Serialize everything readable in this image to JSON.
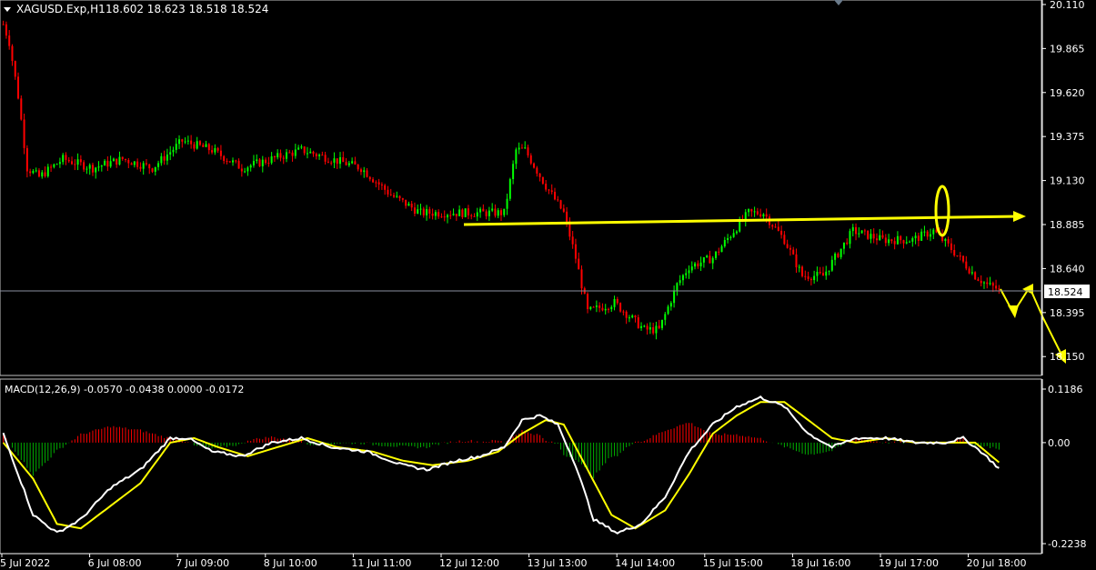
{
  "header": {
    "symbol_label": "XAGUSD.Exp,H1",
    "ohlc_label": "18.602 18.623 18.518 18.524"
  },
  "macd_header": {
    "label": "MACD(12,26,9) -0.0570 -0.0438 0.0000 -0.0172"
  },
  "price_marker": {
    "label": "18.524",
    "value": 18.524
  },
  "colors": {
    "background": "#000000",
    "bull_candle": "#00ff00",
    "bear_candle": "#ff0000",
    "axis": "#ffffff",
    "annotation": "#ffff00",
    "macd_line": "#ffffff",
    "signal_line": "#ffff00",
    "hist_positive": "#ff0000",
    "hist_negative": "#00b000"
  },
  "chart_data": [
    {
      "type": "candlestick",
      "symbol": "XAGUSD.Exp",
      "timeframe": "H1",
      "ylim": [
        18.05,
        20.13
      ],
      "y_ticks": [
        "20.110",
        "19.865",
        "19.620",
        "19.375",
        "19.130",
        "18.885",
        "18.640",
        "18.395",
        "18.150"
      ],
      "x_ticks": [
        "5 Jul 2022",
        "6 Jul 08:00",
        "7 Jul 09:00",
        "8 Jul 10:00",
        "11 Jul 11:00",
        "12 Jul 12:00",
        "13 Jul 13:00",
        "14 Jul 14:00",
        "15 Jul 15:00",
        "18 Jul 16:00",
        "19 Jul 17:00",
        "20 Jul 18:00"
      ],
      "grid": false,
      "current_price": 18.524,
      "path_keypoints": [
        [
          0,
          20.0
        ],
        [
          2,
          19.9
        ],
        [
          5,
          19.6
        ],
        [
          8,
          19.2
        ],
        [
          12,
          19.15
        ],
        [
          20,
          19.25
        ],
        [
          30,
          19.2
        ],
        [
          40,
          19.25
        ],
        [
          50,
          19.2
        ],
        [
          60,
          19.35
        ],
        [
          70,
          19.3
        ],
        [
          80,
          19.2
        ],
        [
          90,
          19.25
        ],
        [
          100,
          19.3
        ],
        [
          110,
          19.25
        ],
        [
          120,
          19.2
        ],
        [
          130,
          19.05
        ],
        [
          140,
          18.95
        ],
        [
          150,
          18.95
        ],
        [
          160,
          18.95
        ],
        [
          168,
          18.95
        ],
        [
          172,
          19.3
        ],
        [
          175,
          19.3
        ],
        [
          182,
          19.1
        ],
        [
          188,
          18.95
        ],
        [
          192,
          18.7
        ],
        [
          196,
          18.4
        ],
        [
          205,
          18.45
        ],
        [
          215,
          18.3
        ],
        [
          220,
          18.3
        ],
        [
          226,
          18.55
        ],
        [
          230,
          18.65
        ],
        [
          238,
          18.7
        ],
        [
          245,
          18.85
        ],
        [
          250,
          18.95
        ],
        [
          255,
          18.95
        ],
        [
          262,
          18.8
        ],
        [
          268,
          18.6
        ],
        [
          275,
          18.6
        ],
        [
          285,
          18.85
        ],
        [
          295,
          18.8
        ],
        [
          305,
          18.8
        ],
        [
          312,
          18.85
        ],
        [
          318,
          18.75
        ],
        [
          326,
          18.6
        ],
        [
          330,
          18.55
        ],
        [
          334,
          18.524
        ]
      ]
    },
    {
      "type": "macd",
      "params": "12,26,9",
      "values": {
        "macd": -0.057,
        "signal": -0.0438,
        "zero": 0.0,
        "histogram": -0.0172
      },
      "ylim": [
        -0.2238,
        0.1186
      ],
      "y_ticks": [
        "0.1186",
        "0.00",
        "-0.2238"
      ],
      "macd_keypoints": [
        [
          0,
          0.02
        ],
        [
          10,
          -0.16
        ],
        [
          18,
          -0.2
        ],
        [
          26,
          -0.17
        ],
        [
          36,
          -0.1
        ],
        [
          46,
          -0.06
        ],
        [
          56,
          0.01
        ],
        [
          62,
          0.01
        ],
        [
          70,
          -0.02
        ],
        [
          80,
          -0.03
        ],
        [
          90,
          0.0
        ],
        [
          100,
          0.01
        ],
        [
          110,
          -0.01
        ],
        [
          122,
          -0.02
        ],
        [
          134,
          -0.05
        ],
        [
          142,
          -0.06
        ],
        [
          152,
          -0.04
        ],
        [
          160,
          -0.03
        ],
        [
          168,
          -0.01
        ],
        [
          174,
          0.05
        ],
        [
          180,
          0.06
        ],
        [
          186,
          0.04
        ],
        [
          192,
          -0.05
        ],
        [
          198,
          -0.17
        ],
        [
          206,
          -0.2
        ],
        [
          214,
          -0.18
        ],
        [
          222,
          -0.12
        ],
        [
          230,
          -0.02
        ],
        [
          238,
          0.04
        ],
        [
          246,
          0.08
        ],
        [
          254,
          0.1
        ],
        [
          262,
          0.08
        ],
        [
          270,
          0.02
        ],
        [
          278,
          -0.01
        ],
        [
          286,
          0.01
        ],
        [
          296,
          0.01
        ],
        [
          306,
          0.0
        ],
        [
          316,
          0.0
        ],
        [
          322,
          0.01
        ],
        [
          328,
          -0.02
        ],
        [
          334,
          -0.057
        ]
      ],
      "signal_keypoints": [
        [
          0,
          0.0
        ],
        [
          10,
          -0.08
        ],
        [
          18,
          -0.18
        ],
        [
          26,
          -0.19
        ],
        [
          36,
          -0.14
        ],
        [
          46,
          -0.09
        ],
        [
          56,
          0.0
        ],
        [
          64,
          0.01
        ],
        [
          72,
          -0.01
        ],
        [
          82,
          -0.03
        ],
        [
          92,
          -0.01
        ],
        [
          102,
          0.01
        ],
        [
          112,
          -0.01
        ],
        [
          124,
          -0.02
        ],
        [
          134,
          -0.04
        ],
        [
          144,
          -0.05
        ],
        [
          156,
          -0.04
        ],
        [
          166,
          -0.02
        ],
        [
          174,
          0.02
        ],
        [
          182,
          0.05
        ],
        [
          188,
          0.04
        ],
        [
          196,
          -0.06
        ],
        [
          204,
          -0.16
        ],
        [
          212,
          -0.19
        ],
        [
          222,
          -0.15
        ],
        [
          230,
          -0.07
        ],
        [
          238,
          0.02
        ],
        [
          246,
          0.06
        ],
        [
          254,
          0.09
        ],
        [
          262,
          0.09
        ],
        [
          270,
          0.05
        ],
        [
          278,
          0.01
        ],
        [
          286,
          0.0
        ],
        [
          296,
          0.01
        ],
        [
          306,
          0.0
        ],
        [
          316,
          0.0
        ],
        [
          326,
          0.0
        ],
        [
          334,
          -0.0438
        ]
      ]
    }
  ]
}
